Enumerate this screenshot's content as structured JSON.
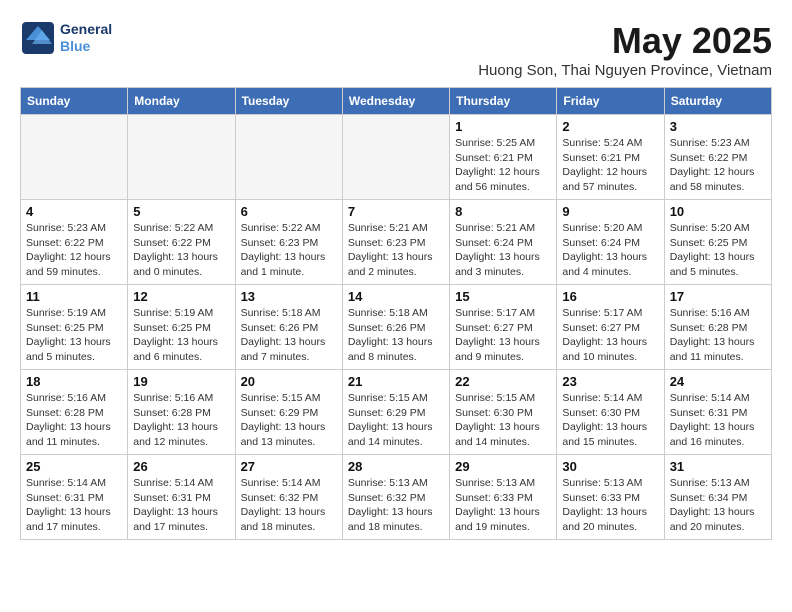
{
  "header": {
    "logo_line1": "General",
    "logo_line2": "Blue",
    "month": "May 2025",
    "location": "Huong Son, Thai Nguyen Province, Vietnam"
  },
  "days_of_week": [
    "Sunday",
    "Monday",
    "Tuesday",
    "Wednesday",
    "Thursday",
    "Friday",
    "Saturday"
  ],
  "weeks": [
    [
      {
        "day": "",
        "info": ""
      },
      {
        "day": "",
        "info": ""
      },
      {
        "day": "",
        "info": ""
      },
      {
        "day": "",
        "info": ""
      },
      {
        "day": "1",
        "info": "Sunrise: 5:25 AM\nSunset: 6:21 PM\nDaylight: 12 hours\nand 56 minutes."
      },
      {
        "day": "2",
        "info": "Sunrise: 5:24 AM\nSunset: 6:21 PM\nDaylight: 12 hours\nand 57 minutes."
      },
      {
        "day": "3",
        "info": "Sunrise: 5:23 AM\nSunset: 6:22 PM\nDaylight: 12 hours\nand 58 minutes."
      }
    ],
    [
      {
        "day": "4",
        "info": "Sunrise: 5:23 AM\nSunset: 6:22 PM\nDaylight: 12 hours\nand 59 minutes."
      },
      {
        "day": "5",
        "info": "Sunrise: 5:22 AM\nSunset: 6:22 PM\nDaylight: 13 hours\nand 0 minutes."
      },
      {
        "day": "6",
        "info": "Sunrise: 5:22 AM\nSunset: 6:23 PM\nDaylight: 13 hours\nand 1 minute."
      },
      {
        "day": "7",
        "info": "Sunrise: 5:21 AM\nSunset: 6:23 PM\nDaylight: 13 hours\nand 2 minutes."
      },
      {
        "day": "8",
        "info": "Sunrise: 5:21 AM\nSunset: 6:24 PM\nDaylight: 13 hours\nand 3 minutes."
      },
      {
        "day": "9",
        "info": "Sunrise: 5:20 AM\nSunset: 6:24 PM\nDaylight: 13 hours\nand 4 minutes."
      },
      {
        "day": "10",
        "info": "Sunrise: 5:20 AM\nSunset: 6:25 PM\nDaylight: 13 hours\nand 5 minutes."
      }
    ],
    [
      {
        "day": "11",
        "info": "Sunrise: 5:19 AM\nSunset: 6:25 PM\nDaylight: 13 hours\nand 5 minutes."
      },
      {
        "day": "12",
        "info": "Sunrise: 5:19 AM\nSunset: 6:25 PM\nDaylight: 13 hours\nand 6 minutes."
      },
      {
        "day": "13",
        "info": "Sunrise: 5:18 AM\nSunset: 6:26 PM\nDaylight: 13 hours\nand 7 minutes."
      },
      {
        "day": "14",
        "info": "Sunrise: 5:18 AM\nSunset: 6:26 PM\nDaylight: 13 hours\nand 8 minutes."
      },
      {
        "day": "15",
        "info": "Sunrise: 5:17 AM\nSunset: 6:27 PM\nDaylight: 13 hours\nand 9 minutes."
      },
      {
        "day": "16",
        "info": "Sunrise: 5:17 AM\nSunset: 6:27 PM\nDaylight: 13 hours\nand 10 minutes."
      },
      {
        "day": "17",
        "info": "Sunrise: 5:16 AM\nSunset: 6:28 PM\nDaylight: 13 hours\nand 11 minutes."
      }
    ],
    [
      {
        "day": "18",
        "info": "Sunrise: 5:16 AM\nSunset: 6:28 PM\nDaylight: 13 hours\nand 11 minutes."
      },
      {
        "day": "19",
        "info": "Sunrise: 5:16 AM\nSunset: 6:28 PM\nDaylight: 13 hours\nand 12 minutes."
      },
      {
        "day": "20",
        "info": "Sunrise: 5:15 AM\nSunset: 6:29 PM\nDaylight: 13 hours\nand 13 minutes."
      },
      {
        "day": "21",
        "info": "Sunrise: 5:15 AM\nSunset: 6:29 PM\nDaylight: 13 hours\nand 14 minutes."
      },
      {
        "day": "22",
        "info": "Sunrise: 5:15 AM\nSunset: 6:30 PM\nDaylight: 13 hours\nand 14 minutes."
      },
      {
        "day": "23",
        "info": "Sunrise: 5:14 AM\nSunset: 6:30 PM\nDaylight: 13 hours\nand 15 minutes."
      },
      {
        "day": "24",
        "info": "Sunrise: 5:14 AM\nSunset: 6:31 PM\nDaylight: 13 hours\nand 16 minutes."
      }
    ],
    [
      {
        "day": "25",
        "info": "Sunrise: 5:14 AM\nSunset: 6:31 PM\nDaylight: 13 hours\nand 17 minutes."
      },
      {
        "day": "26",
        "info": "Sunrise: 5:14 AM\nSunset: 6:31 PM\nDaylight: 13 hours\nand 17 minutes."
      },
      {
        "day": "27",
        "info": "Sunrise: 5:14 AM\nSunset: 6:32 PM\nDaylight: 13 hours\nand 18 minutes."
      },
      {
        "day": "28",
        "info": "Sunrise: 5:13 AM\nSunset: 6:32 PM\nDaylight: 13 hours\nand 18 minutes."
      },
      {
        "day": "29",
        "info": "Sunrise: 5:13 AM\nSunset: 6:33 PM\nDaylight: 13 hours\nand 19 minutes."
      },
      {
        "day": "30",
        "info": "Sunrise: 5:13 AM\nSunset: 6:33 PM\nDaylight: 13 hours\nand 20 minutes."
      },
      {
        "day": "31",
        "info": "Sunrise: 5:13 AM\nSunset: 6:34 PM\nDaylight: 13 hours\nand 20 minutes."
      }
    ]
  ]
}
